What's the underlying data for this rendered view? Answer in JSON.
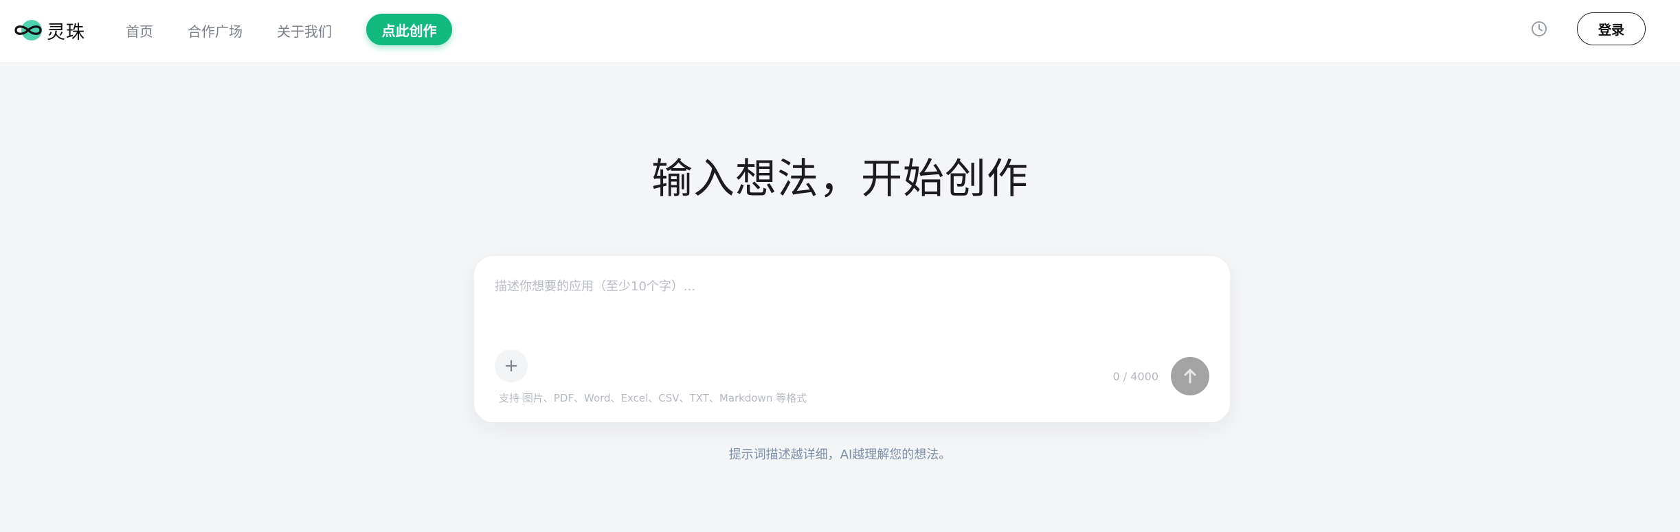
{
  "header": {
    "logo_text": "灵珠",
    "nav": [
      {
        "label": "首页"
      },
      {
        "label": "合作广场"
      },
      {
        "label": "关于我们"
      }
    ],
    "cta_label": "点此创作",
    "history_icon": "clock-icon",
    "login_label": "登录"
  },
  "hero": {
    "title": "输入想法，开始创作"
  },
  "composer": {
    "placeholder": "描述你想要的应用（至少10个字）...",
    "value": "",
    "attach_icon": "plus-icon",
    "formats_note": "支持 图片、PDF、Word、Excel、CSV、TXT、Markdown 等格式",
    "counter": "0 / 4000",
    "send_icon": "arrow-up-icon"
  },
  "hint": "提示词描述越详细，AI越理解您的想法。",
  "colors": {
    "brand_green": "#12b97e",
    "logo_teal": "#4fd1b0",
    "background": "#f4f5f7",
    "send_disabled": "#a3a3a3"
  }
}
